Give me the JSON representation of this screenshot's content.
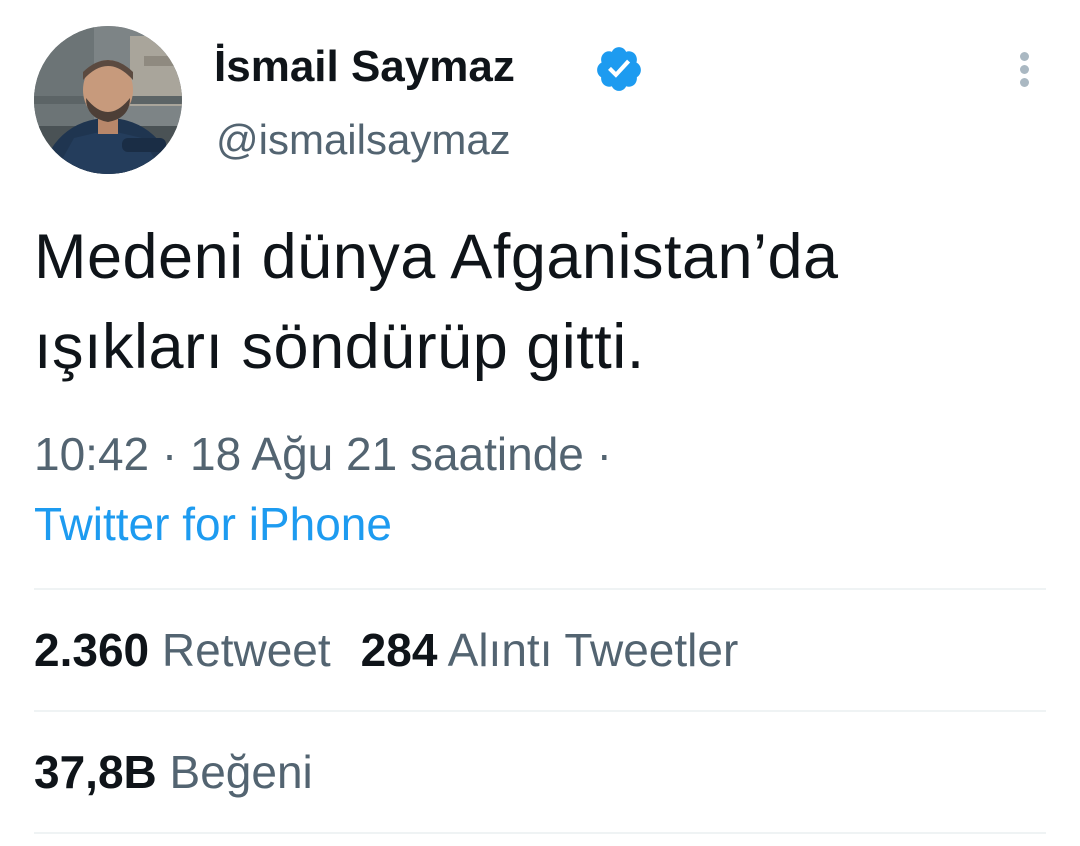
{
  "author": {
    "name": "İsmail Saymaz",
    "handle": "@ismailsaymaz",
    "verified": true,
    "verified_color": "#1d9bf0"
  },
  "tweet": {
    "text_lines": [
      "Medeni dünya Afganistan’da",
      "ışıkları söndürüp gitti."
    ],
    "time": "10:42 · 18 Ağu 21 saatinde ·",
    "source": "Twitter for iPhone"
  },
  "stats": {
    "retweets": {
      "count": "2.360",
      "label": "Retweet"
    },
    "quotes": {
      "count": "284",
      "label": "Alıntı Tweetler"
    },
    "likes": {
      "count": "37,8B",
      "label": "Beğeni"
    }
  },
  "colors": {
    "text_primary": "#0f1419",
    "text_secondary": "#536471",
    "link": "#1d9bf0",
    "divider": "#eff3f4"
  },
  "icons": {
    "verified": "verified-badge-icon",
    "more": "more-vertical-icon"
  }
}
